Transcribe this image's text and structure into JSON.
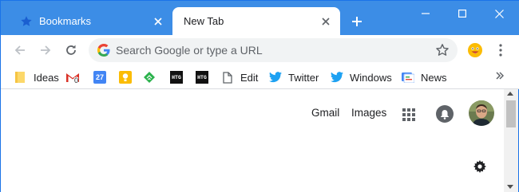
{
  "tabs": [
    {
      "title": "Bookmarks",
      "icon": "star-icon",
      "active": false
    },
    {
      "title": "New Tab",
      "icon": "",
      "active": true
    }
  ],
  "window_controls": [
    "minimize",
    "maximize",
    "close"
  ],
  "toolbar": {
    "omnibox_placeholder": "Search Google or type a URL",
    "omnibox_value": ""
  },
  "bookmarks": [
    {
      "label": "Ideas",
      "icon": "folder-icon"
    },
    {
      "label": "",
      "icon": "gmail-icon",
      "badge": "0"
    },
    {
      "label": "",
      "icon": "calendar-icon",
      "badge": "27"
    },
    {
      "label": "",
      "icon": "keep-icon"
    },
    {
      "label": "",
      "icon": "feedly-icon"
    },
    {
      "label": "",
      "icon": "htg-icon",
      "text": "HTG"
    },
    {
      "label": "",
      "icon": "htg-icon",
      "text": "HTG"
    },
    {
      "label": "Edit",
      "icon": "page-icon"
    },
    {
      "label": "Twitter",
      "icon": "twitter-icon"
    },
    {
      "label": "Windows",
      "icon": "twitter-icon"
    },
    {
      "label": "News",
      "icon": "news-icon"
    }
  ],
  "content": {
    "gmail": "Gmail",
    "images": "Images"
  },
  "colors": {
    "tabstrip": "#3c8de6",
    "accent": "#1a73e8",
    "text": "#202124",
    "icon_gray": "#5f6368"
  }
}
